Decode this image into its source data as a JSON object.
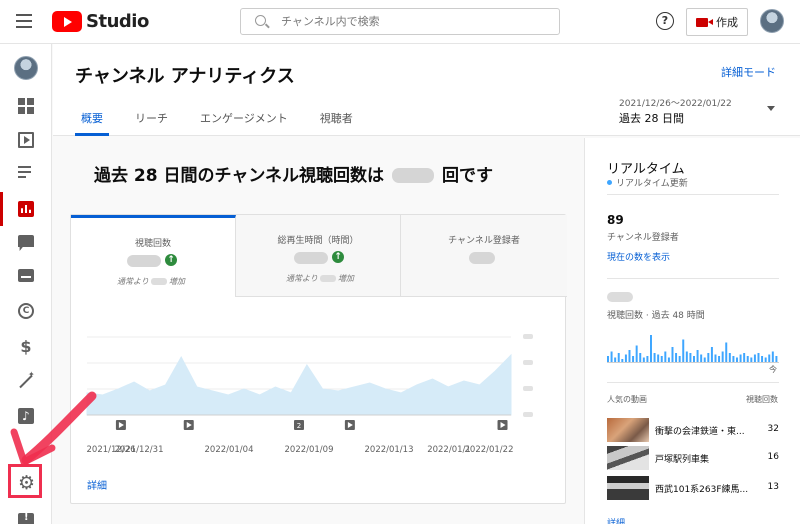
{
  "header": {
    "logo_text": "Studio",
    "search_placeholder": "チャンネル内で検索",
    "help_icon": "help-icon",
    "create_label": "作成"
  },
  "sidebar": {
    "items": [
      {
        "name": "dashboard",
        "icon": "dashboard-icon"
      },
      {
        "name": "content",
        "icon": "video-content-icon"
      },
      {
        "name": "playlists",
        "icon": "playlist-icon"
      },
      {
        "name": "analytics",
        "icon": "analytics-icon",
        "active": true
      },
      {
        "name": "comments",
        "icon": "comment-icon"
      },
      {
        "name": "subtitles",
        "icon": "subtitles-icon"
      },
      {
        "name": "copyright",
        "icon": "copyright-icon"
      },
      {
        "name": "monetization",
        "icon": "dollar-icon"
      },
      {
        "name": "customization",
        "icon": "magic-wand-icon"
      },
      {
        "name": "audio-library",
        "icon": "audio-library-icon"
      },
      {
        "name": "settings",
        "icon": "gear-icon"
      },
      {
        "name": "feedback",
        "icon": "feedback-icon"
      }
    ]
  },
  "page": {
    "title": "チャンネル アナリティクス",
    "detail_mode": "詳細モード",
    "tabs": [
      "概要",
      "リーチ",
      "エンゲージメント",
      "視聴者"
    ],
    "active_tab": 0,
    "date_range": "2021/12/26～2022/01/22",
    "date_label": "過去 28 日間"
  },
  "summary": {
    "headline_prefix": "過去 28 日間のチャンネル視聴回数は",
    "headline_suffix": "回です"
  },
  "metrics": [
    {
      "label": "視聴回数",
      "trend_icon": "arrow-up-icon",
      "sub_prefix": "通常より",
      "sub_suffix": "増加"
    },
    {
      "label": "総再生時間（時間）",
      "trend_icon": "arrow-up-icon",
      "sub_prefix": "通常より",
      "sub_suffix": "増加"
    },
    {
      "label": "チャンネル登録者"
    }
  ],
  "chart_data": {
    "type": "area",
    "x": [
      "2021/12/26",
      "2021/12/31",
      "2022/01/04",
      "2022/01/09",
      "2022/01/13",
      "2022/01/18",
      "2022/01/22"
    ],
    "x_tick_labels": [
      "2021/12/26",
      "2021/12/31",
      "2022/01/04",
      "2022/01/09",
      "2022/01/13",
      "2022/01/1",
      "2022/01/22"
    ],
    "values": [
      0.22,
      0.2,
      0.26,
      0.33,
      0.24,
      0.3,
      0.58,
      0.28,
      0.24,
      0.2,
      0.26,
      0.2,
      0.28,
      0.22,
      0.5,
      0.26,
      0.24,
      0.28,
      0.32,
      0.26,
      0.22,
      0.3,
      0.36,
      0.28,
      0.34,
      0.3,
      0.44,
      0.6
    ],
    "ylim": [
      0,
      1
    ],
    "grid": true,
    "markers": [
      {
        "label": "",
        "icon": "play-marker-icon"
      },
      {
        "label": "",
        "icon": "play-marker-icon"
      },
      {
        "label": "2",
        "icon": "count-marker"
      },
      {
        "label": "",
        "icon": "play-marker-icon"
      },
      {
        "label": "",
        "icon": "play-marker-icon"
      }
    ],
    "detail_link": "詳細"
  },
  "realtime": {
    "title": "リアルタイム",
    "subtitle": "リアルタイム更新",
    "subscriber_count": "89",
    "subscriber_label": "チャンネル登録者",
    "show_current": "現在の数を表示",
    "views_label": "視聴回数 · 過去 48 時間",
    "hourly_bars": [
      0.2,
      0.35,
      0.15,
      0.3,
      0.1,
      0.25,
      0.4,
      0.2,
      0.55,
      0.3,
      0.15,
      0.2,
      0.9,
      0.3,
      0.25,
      0.2,
      0.35,
      0.15,
      0.5,
      0.3,
      0.2,
      0.75,
      0.35,
      0.3,
      0.2,
      0.4,
      0.25,
      0.15,
      0.3,
      0.5,
      0.25,
      0.2,
      0.35,
      0.65,
      0.3,
      0.2,
      0.15,
      0.25,
      0.3,
      0.2,
      0.15,
      0.25,
      0.3,
      0.2,
      0.15,
      0.25,
      0.35,
      0.2
    ],
    "now_label": "今",
    "popular_header": "人気の動画",
    "popular_views_header": "視聴回数",
    "videos": [
      {
        "title": "衝撃の会津鉄道・東...",
        "views": "32"
      },
      {
        "title": "戸塚駅列車集",
        "views": "16"
      },
      {
        "title": "西武101系263F練馬...",
        "views": "13"
      }
    ],
    "detail_link": "詳細"
  }
}
